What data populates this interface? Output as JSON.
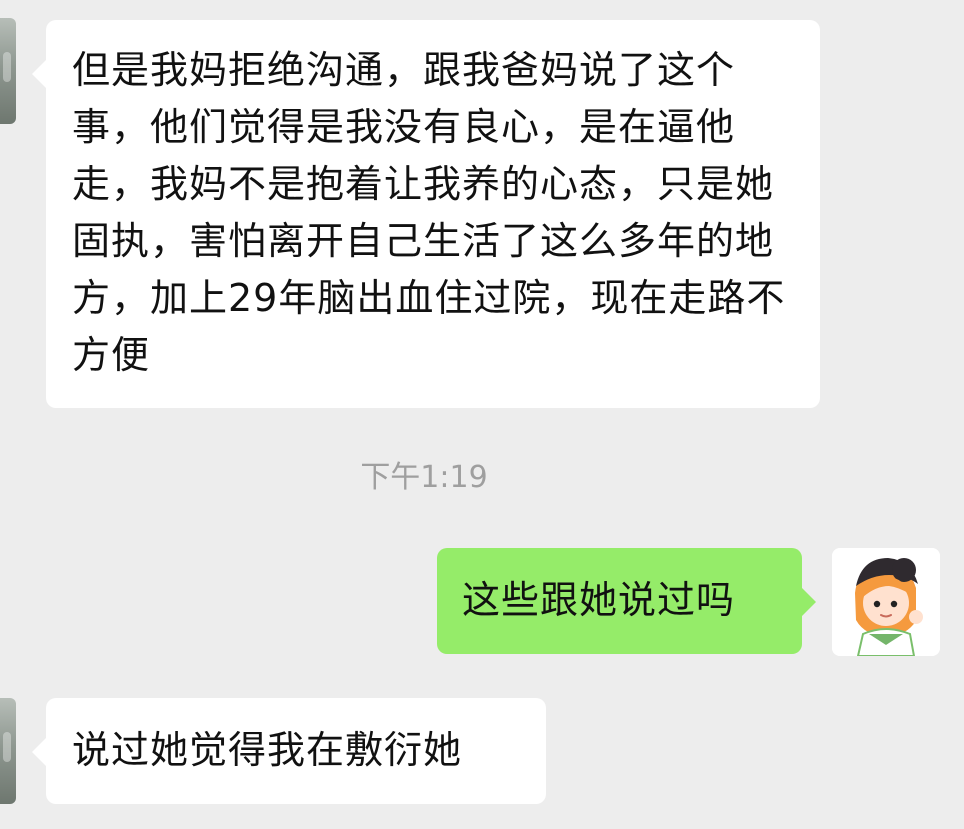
{
  "chat": {
    "messages": [
      {
        "side": "left",
        "text": "但是我妈拒绝沟通，跟我爸妈说了这个事，他们觉得是我没有良心，是在逼他走，我妈不是抱着让我养的心态，只是她固执，害怕离开自己生活了这么多年的地方，加上29年脑出血住过院，现在走路不方便"
      },
      {
        "side": "right",
        "text": "这些跟她说过吗"
      },
      {
        "side": "left",
        "text": "说过她觉得我在敷衍她"
      }
    ],
    "timestamp": "下午1:19"
  },
  "colors": {
    "background": "#ededed",
    "incoming_bubble": "#ffffff",
    "outgoing_bubble": "#95ec69",
    "timestamp_text": "#9f9f9f"
  },
  "icons": {
    "left_avatar": "contact-avatar-icon",
    "right_avatar": "user-avatar-icon"
  }
}
